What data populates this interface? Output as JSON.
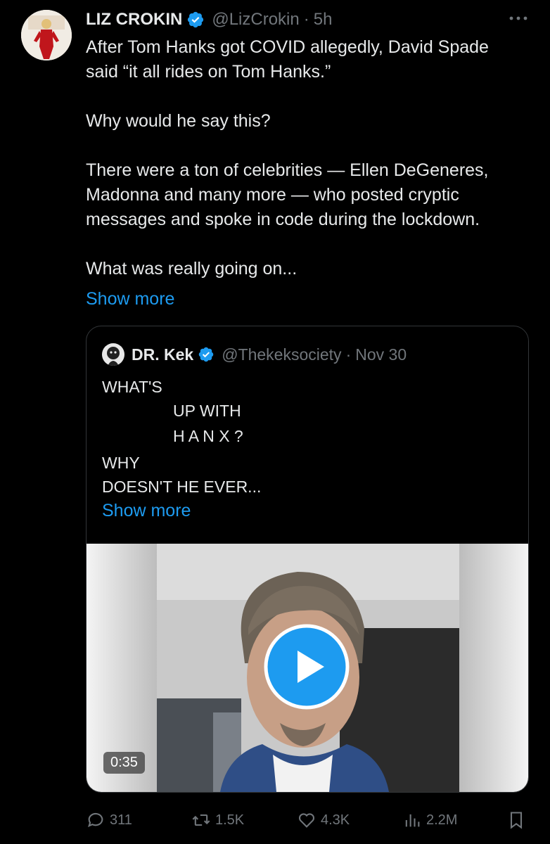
{
  "author": {
    "name": "LIZ CROKIN",
    "handle": "@LizCrokin",
    "time": "5h"
  },
  "tweet": {
    "line1": "After Tom Hanks got COVID allegedly, David Spade",
    "line2": "said “it all rides on Tom Hanks.”",
    "line3": "Why would he say this?",
    "line4": "There were a ton of celebrities — Ellen DeGeneres,",
    "line5": "Madonna and many more — who posted cryptic",
    "line6": "messages and spoke in code during the lockdown.",
    "line7": "What was really going on...",
    "show_more": "Show more"
  },
  "quote": {
    "name": "DR. Kek",
    "handle": "@Thekeksociety",
    "date": "Nov 30",
    "lines": {
      "l1": "WHAT'S",
      "l2": "UP WITH",
      "l3": "H A N X ?",
      "l4": "WHY",
      "l5": "DOESN'T HE EVER..."
    },
    "show_more": "Show more",
    "video_duration": "0:35"
  },
  "actions": {
    "replies": "311",
    "reposts": "1.5K",
    "likes": "4.3K",
    "views": "2.2M"
  },
  "colors": {
    "background": "#000000",
    "text": "#e7e9ea",
    "secondary": "#71767b",
    "accent": "#1d9bf0"
  },
  "icons": [
    "more-icon",
    "verified-icon",
    "play-icon",
    "reply-icon",
    "repost-icon",
    "like-icon",
    "views-icon",
    "bookmark-icon"
  ]
}
